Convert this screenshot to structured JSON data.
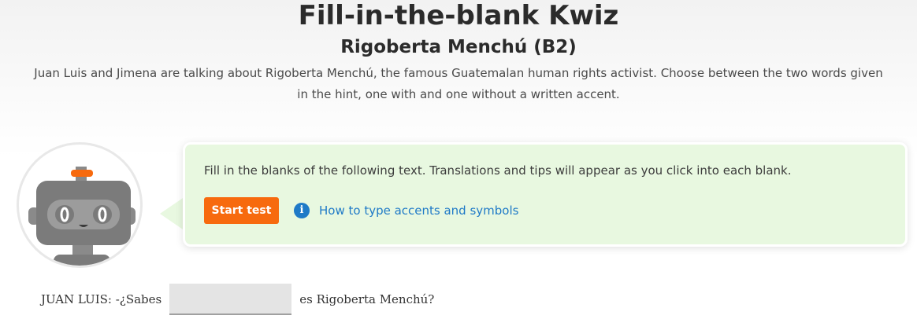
{
  "header": {
    "title": "Fill-in-the-blank Kwiz",
    "subtitle": "Rigoberta Menchú (B2)",
    "intro": "Juan Luis and Jimena are talking about Rigoberta Menchú, the famous Guatemalan human rights activist. Choose between the two words given in the hint, one with and one without a written accent."
  },
  "instructions": {
    "text": "Fill in the blanks of the following text. Translations and tips will appear as you click into each blank.",
    "start_label": "Start test",
    "help_link": "How to type accents and symbols",
    "info_icon_glyph": "i"
  },
  "exercise": {
    "line1_before": "JUAN LUIS: -¿Sabes",
    "line1_blank_value": "",
    "line1_after": "es Rigoberta Menchú?"
  },
  "colors": {
    "accent_orange": "#f76a0e",
    "link_blue": "#1f7ac7",
    "bubble_green": "#e8f8e0"
  }
}
